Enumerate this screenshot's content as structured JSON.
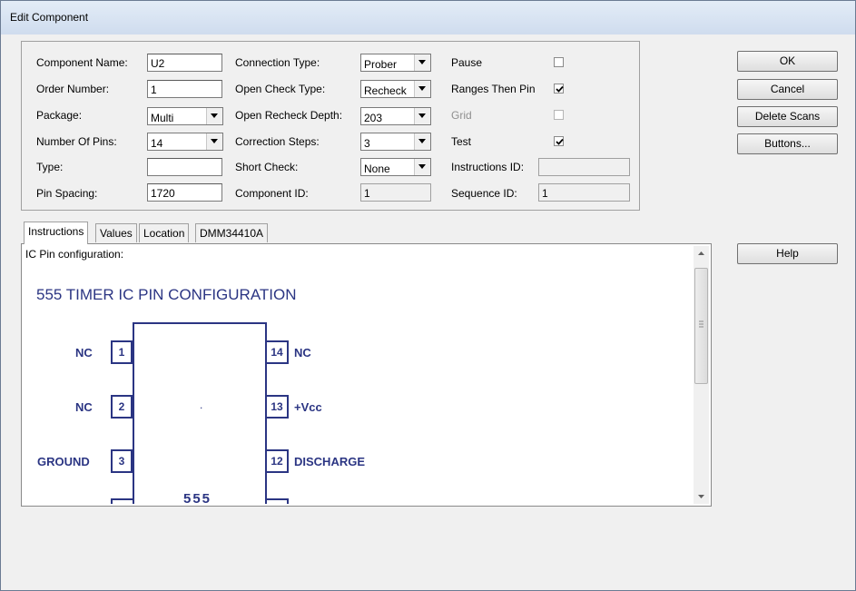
{
  "window": {
    "title": "Edit Component"
  },
  "form": {
    "component_name_label": "Component Name:",
    "component_name": "U2",
    "order_number_label": "Order Number:",
    "order_number": "1",
    "package_label": "Package:",
    "package": "Multi",
    "number_of_pins_label": "Number Of Pins:",
    "number_of_pins": "14",
    "type_label": "Type:",
    "type": "",
    "pin_spacing_label": "Pin Spacing:",
    "pin_spacing": "1720",
    "connection_type_label": "Connection Type:",
    "connection_type": "Prober",
    "open_check_type_label": "Open Check Type:",
    "open_check_type": "Recheck",
    "open_recheck_depth_label": "Open Recheck Depth:",
    "open_recheck_depth": "203",
    "correction_steps_label": "Correction Steps:",
    "correction_steps": "3",
    "short_check_label": "Short Check:",
    "short_check": "None",
    "component_id_label": "Component ID:",
    "component_id": "1",
    "pause_label": "Pause",
    "pause_checked": false,
    "ranges_then_pin_label": "Ranges Then Pin",
    "ranges_then_pin_checked": true,
    "grid_label": "Grid",
    "grid_checked": false,
    "test_label": "Test",
    "test_checked": true,
    "instructions_id_label": "Instructions ID:",
    "instructions_id": "",
    "sequence_id_label": "Sequence ID:",
    "sequence_id": "1"
  },
  "buttons": {
    "ok": "OK",
    "cancel": "Cancel",
    "delete_scans": "Delete Scans",
    "buttons": "Buttons...",
    "help": "Help"
  },
  "tabs": [
    "Instructions",
    "Values",
    "Location",
    "DMM34410A"
  ],
  "instructions": {
    "caption": "IC Pin configuration:",
    "diagram_title": "555 TIMER IC PIN CONFIGURATION",
    "chip_label": "555",
    "left_pins": [
      {
        "num": "1",
        "label": "NC"
      },
      {
        "num": "2",
        "label": "NC"
      },
      {
        "num": "3",
        "label": "GROUND"
      }
    ],
    "right_pins": [
      {
        "num": "14",
        "label": "NC"
      },
      {
        "num": "13",
        "label": "+Vcc"
      },
      {
        "num": "12",
        "label": "DISCHARGE"
      }
    ],
    "chip_dot": "."
  }
}
